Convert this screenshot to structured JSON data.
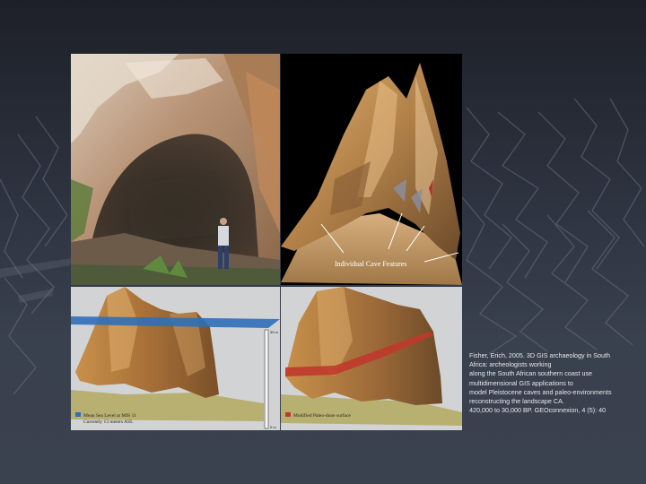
{
  "figure": {
    "top_right_label": "Individual Cave Features",
    "bottom_left_legend_line1": "Mean Sea Level at MIS 11",
    "bottom_left_legend_line2": "Currently 13 meters ASL",
    "bottom_left_scale_top": "30 m",
    "bottom_left_scale_bottom": "0 m",
    "bottom_right_legend": "Modified Paleo-dune surface"
  },
  "caption": {
    "lines": [
      "Fisher, Erich, 2005. 3D GIS archaeology in South",
      "Africa: archeologists working",
      "along the South African southern coast use",
      "multidimensional GIS applications to",
      "model Pleistocene caves and paleo-environments",
      "reconstructing the landscape CA.",
      "420,000 to 30,000 BP. GEOconnexion, 4 (5): 40"
    ]
  },
  "colors": {
    "background": "#2b303c",
    "sea_level": "#2f6fb8",
    "paleo_dune": "#c0392b",
    "cave_surface": "#b88a4a"
  }
}
